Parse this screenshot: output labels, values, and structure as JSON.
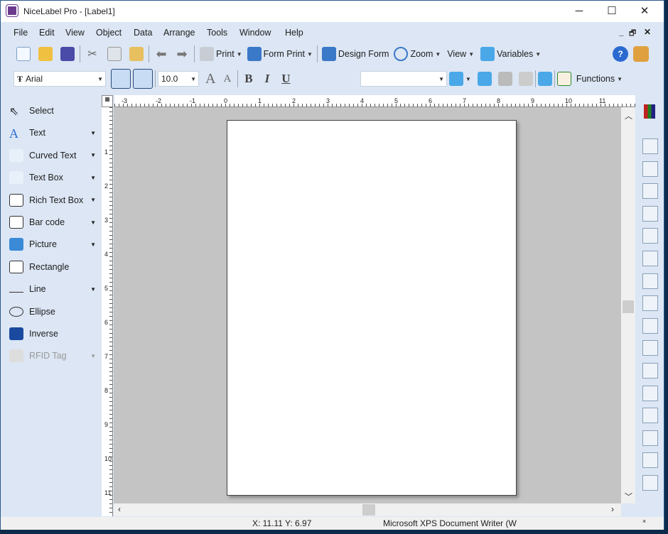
{
  "window": {
    "title": "NiceLabel Pro - [Label1]",
    "minimize": "─",
    "maximize": "☐",
    "close": "✕"
  },
  "menu": [
    "File",
    "Edit",
    "View",
    "Object",
    "Data",
    "Arrange",
    "Tools",
    "Window",
    "Help"
  ],
  "menu_mnemonic": [
    "F",
    "E",
    "V",
    "O",
    "D",
    "A",
    "l",
    "W",
    "H"
  ],
  "mdi_controls": {
    "minimize": "_",
    "restore": "🗗",
    "close": "✕"
  },
  "toolbar1": {
    "print": "Print",
    "form_print": "Form Print",
    "design_form": "Design Form",
    "zoom": "Zoom",
    "view": "View",
    "variables": "Variables"
  },
  "toolbar2": {
    "font": "Arial",
    "size": "10.0",
    "bold": "B",
    "italic": "I",
    "underline": "U",
    "variable_combo": "",
    "functions": "Functions"
  },
  "tools": [
    {
      "label": "Select",
      "icon": "cursor-icon",
      "dropdown": false,
      "disabled": false
    },
    {
      "label": "Text",
      "icon": "text-icon",
      "dropdown": true,
      "disabled": false
    },
    {
      "label": "Curved Text",
      "icon": "curved-text-icon",
      "dropdown": true,
      "disabled": false
    },
    {
      "label": "Text Box",
      "icon": "text-box-icon",
      "dropdown": true,
      "disabled": false
    },
    {
      "label": "Rich Text Box",
      "icon": "rtf-icon",
      "dropdown": true,
      "disabled": false
    },
    {
      "label": "Bar code",
      "icon": "barcode-icon",
      "dropdown": true,
      "disabled": false
    },
    {
      "label": "Picture",
      "icon": "picture-icon",
      "dropdown": true,
      "disabled": false
    },
    {
      "label": "Rectangle",
      "icon": "rectangle-icon",
      "dropdown": false,
      "disabled": false
    },
    {
      "label": "Line",
      "icon": "line-icon",
      "dropdown": true,
      "disabled": false
    },
    {
      "label": "Ellipse",
      "icon": "ellipse-icon",
      "dropdown": false,
      "disabled": false
    },
    {
      "label": "Inverse",
      "icon": "inverse-icon",
      "dropdown": false,
      "disabled": false
    },
    {
      "label": "RFID Tag",
      "icon": "rfid-icon",
      "dropdown": true,
      "disabled": true
    }
  ],
  "ruler_h": [
    "-3",
    "-2",
    "-1",
    "0",
    "1",
    "2",
    "3",
    "4",
    "5",
    "6",
    "7",
    "8",
    "9",
    "10",
    "11"
  ],
  "ruler_v": [
    "1",
    "2",
    "3",
    "4",
    "5",
    "6",
    "7",
    "8",
    "9",
    "10",
    "11"
  ],
  "right_tools": [
    "align-left-icon",
    "align-center-h-icon",
    "align-right-icon",
    "align-top-icon",
    "align-center-v-icon",
    "align-bottom-icon",
    "distribute-h-icon",
    "distribute-v-icon",
    "rotate-icon",
    "bring-front-icon",
    "send-back-icon",
    "bring-forward-icon",
    "send-backward-icon",
    "group-icon",
    "ungroup-icon",
    "properties-icon"
  ],
  "status": {
    "coords": "X: 11.11 Y:  6.97",
    "printer": "Microsoft XPS Document Writer (W",
    "close": "×"
  },
  "colors": {
    "chrome": "#dce6f4",
    "canvas": "#c4c4c4",
    "accent": "#2a6ad0"
  }
}
